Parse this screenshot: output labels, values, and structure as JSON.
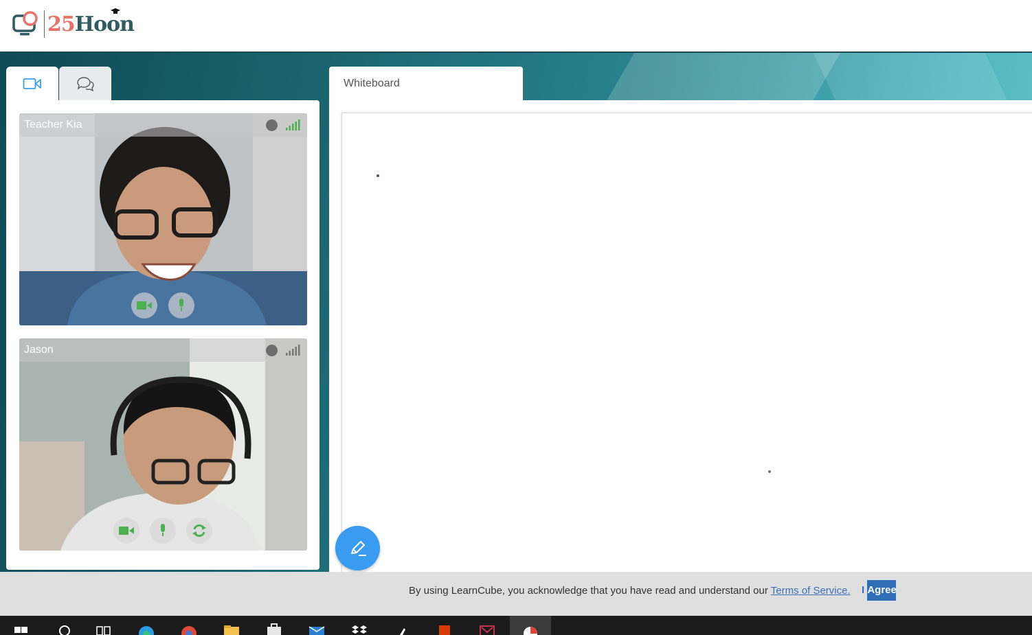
{
  "app": {
    "logo_number": "25",
    "logo_word": "Hoon"
  },
  "left_tabs": [
    {
      "icon": "video-camera-icon",
      "active": true
    },
    {
      "icon": "chat-bubbles-icon",
      "active": false
    }
  ],
  "participants": [
    {
      "name": "Teacher Kia",
      "signal_color": "#4caf50",
      "controls": [
        "camera-icon",
        "microphone-icon"
      ]
    },
    {
      "name": "Jason",
      "signal_color": "#777777",
      "controls": [
        "camera-icon",
        "microphone-icon",
        "switch-camera-icon"
      ]
    }
  ],
  "whiteboard": {
    "tab_label": "Whiteboard",
    "tool_icon": "pen-icon"
  },
  "consent": {
    "text": "By using LearnCube, you acknowledge that you have read and understand our",
    "link_text": "Terms of Service.",
    "agree_prefix": "I",
    "agree_label": "Agree"
  },
  "taskbar": {
    "icons": [
      "windows-start-icon",
      "search-icon",
      "task-view-icon",
      "edge-icon",
      "chrome-icon",
      "file-explorer-icon",
      "store-icon",
      "mail-icon",
      "dropbox-icon",
      "app-icon",
      "office-icon",
      "app-icon",
      "active-app-icon"
    ]
  },
  "colors": {
    "accent_blue": "#3a9cf0",
    "brand_coral": "#e8736b",
    "brand_teal": "#2f5b61",
    "icon_green": "#4caf50"
  }
}
